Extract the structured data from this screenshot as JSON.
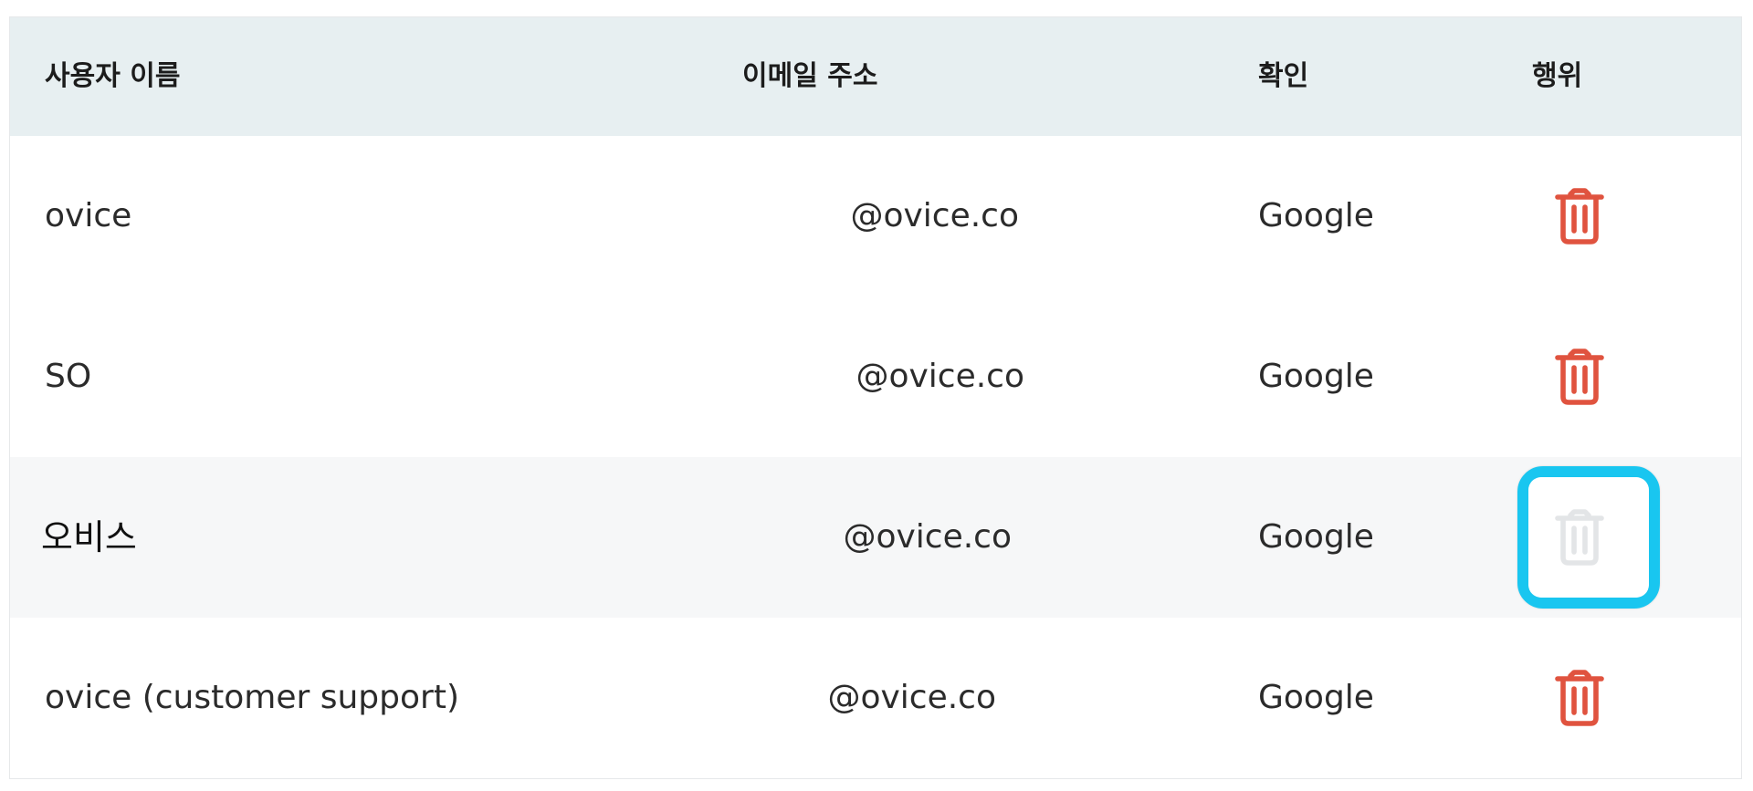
{
  "table": {
    "headers": {
      "name": "사용자 이름",
      "email": "이메일 주소",
      "auth": "확인",
      "action": "행위"
    },
    "rows": [
      {
        "name": "ovice",
        "email": "@ovice.co",
        "auth": "Google",
        "delete_enabled": true
      },
      {
        "name": "SO",
        "email": "@ovice.co",
        "auth": "Google",
        "delete_enabled": true
      },
      {
        "name": "오비스",
        "email": "@ovice.co",
        "auth": "Google",
        "delete_enabled": false
      },
      {
        "name": "ovice (customer support)",
        "email": "@ovice.co",
        "auth": "Google",
        "delete_enabled": true
      }
    ]
  },
  "icons": {
    "delete": "trash-icon"
  },
  "colors": {
    "header_bg": "#e7eff1",
    "delete_active": "#e0533f",
    "delete_disabled": "#e3e5e7",
    "focus_ring": "#19c6f0",
    "hover_row": "#f6f7f8"
  }
}
